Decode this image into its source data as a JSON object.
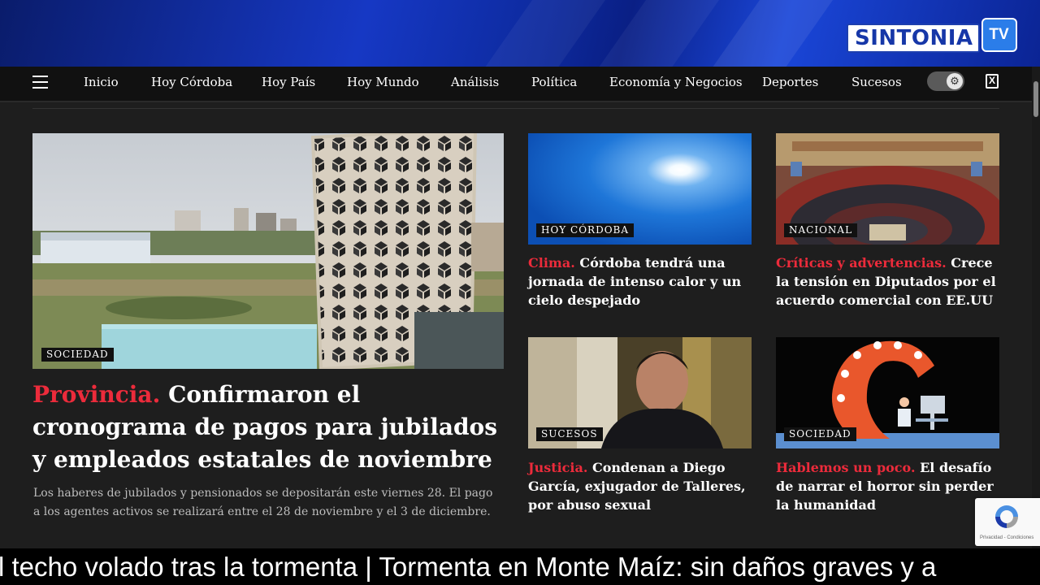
{
  "brand": {
    "name": "SINTONIA",
    "tv": "TV"
  },
  "nav": {
    "items": [
      "Inicio",
      "Hoy Córdoba",
      "Hoy País",
      "Hoy Mundo",
      "Análisis",
      "Política",
      "Economía y Negocios",
      "Deportes",
      "Sucesos"
    ]
  },
  "main_article": {
    "tag": "SOCIEDAD",
    "kicker": "Provincia.",
    "title": "Confirmaron el cronograma de pagos para jubilados y empleados estatales de noviembre",
    "summary": "Los haberes de jubilados y pensionados se depositarán este viernes 28. El pago a los agentes activos se realizará entre el 28 de noviembre y el 3 de diciembre."
  },
  "articles": [
    {
      "tag": "HOY CÓRDOBA",
      "kicker": "Clima.",
      "title": "Córdoba tendrá una jornada de intenso calor y un cielo despejado"
    },
    {
      "tag": "NACIONAL",
      "kicker": "Críticas y advertencias.",
      "title": "Crece la tensión en Diputados por el acuerdo comercial con EE.UU"
    },
    {
      "tag": "SUCESOS",
      "kicker": "Justicia.",
      "title": "Condenan a Diego García, exjugador de Talleres, por abuso sexual"
    },
    {
      "tag": "SOCIEDAD",
      "kicker": "Hablemos un poco.",
      "title": "El desafío de narrar el horror sin perder la humanidad"
    }
  ],
  "recaptcha": {
    "footer": "Privacidad - Condiciones"
  },
  "ticker": {
    "text": "l techo volado tras la tormenta | Tormenta en Monte Maíz: sin daños graves y a"
  },
  "colors": {
    "accent": "#ec2b3b",
    "background": "#1e1e1e",
    "banner": "#1638c4"
  }
}
